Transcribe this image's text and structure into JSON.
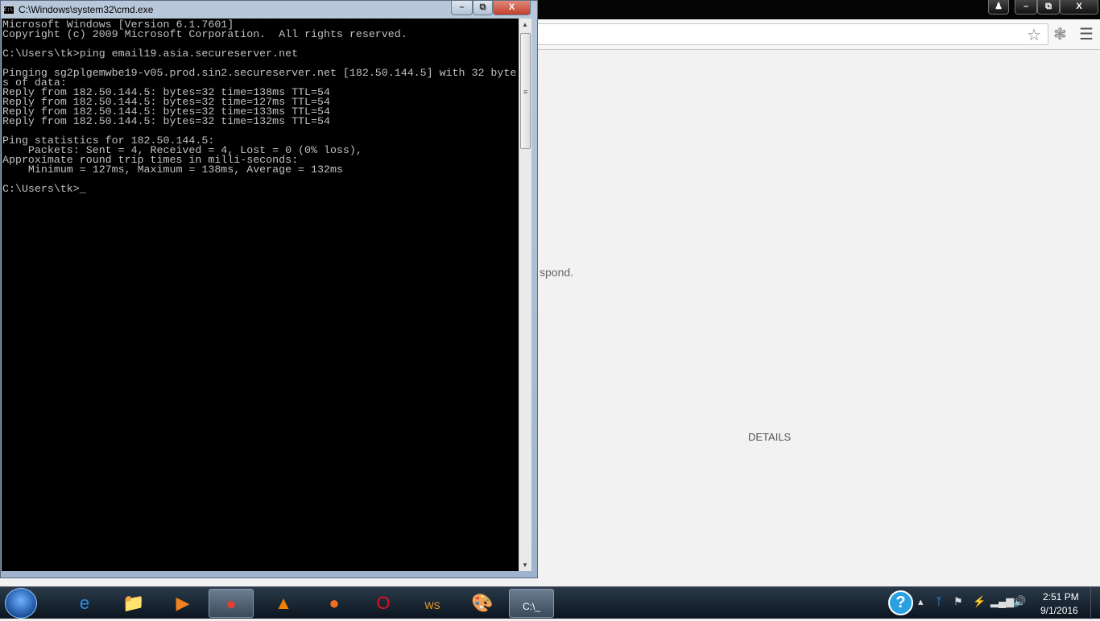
{
  "cmd": {
    "title": "C:\\Windows\\system32\\cmd.exe",
    "icon_label": "C:\\",
    "minimize": "–",
    "maximize": "⧉",
    "close": "X",
    "lines": [
      "Microsoft Windows [Version 6.1.7601]",
      "Copyright (c) 2009 Microsoft Corporation.  All rights reserved.",
      "",
      "C:\\Users\\tk>ping email19.asia.secureserver.net",
      "",
      "Pinging sg2plgemwbe19-v05.prod.sin2.secureserver.net [182.50.144.5] with 32 byte",
      "s of data:",
      "Reply from 182.50.144.5: bytes=32 time=138ms TTL=54",
      "Reply from 182.50.144.5: bytes=32 time=127ms TTL=54",
      "Reply from 182.50.144.5: bytes=32 time=133ms TTL=54",
      "Reply from 182.50.144.5: bytes=32 time=132ms TTL=54",
      "",
      "Ping statistics for 182.50.144.5:",
      "    Packets: Sent = 4, Received = 4, Lost = 0 (0% loss),",
      "Approximate round trip times in milli-seconds:",
      "    Minimum = 127ms, Maximum = 138ms, Average = 132ms",
      "",
      "C:\\Users\\tk>_"
    ]
  },
  "browser": {
    "error_fragment": "spond.",
    "details_button": "DETAILS"
  },
  "taskbar": {
    "apps": [
      {
        "name": "internet-explorer",
        "glyph": "e",
        "color": "#2a8ae0"
      },
      {
        "name": "file-explorer",
        "glyph": "📁",
        "color": "#f0c040"
      },
      {
        "name": "media-player",
        "glyph": "▶",
        "color": "#f08020"
      },
      {
        "name": "chrome",
        "glyph": "●",
        "color": "#e04030",
        "active": true
      },
      {
        "name": "vlc",
        "glyph": "▲",
        "color": "#f08000"
      },
      {
        "name": "firefox",
        "glyph": "●",
        "color": "#f07020"
      },
      {
        "name": "opera",
        "glyph": "O",
        "color": "#e01020"
      },
      {
        "name": "ws-app",
        "glyph": "WS",
        "color": "#f0a020"
      },
      {
        "name": "paint",
        "glyph": "🎨",
        "color": "#ffffff"
      },
      {
        "name": "cmd",
        "glyph": "C:\\_",
        "color": "#ffffff",
        "active": true
      }
    ],
    "help": "?",
    "time": "2:51 PM",
    "date": "9/1/2016"
  }
}
